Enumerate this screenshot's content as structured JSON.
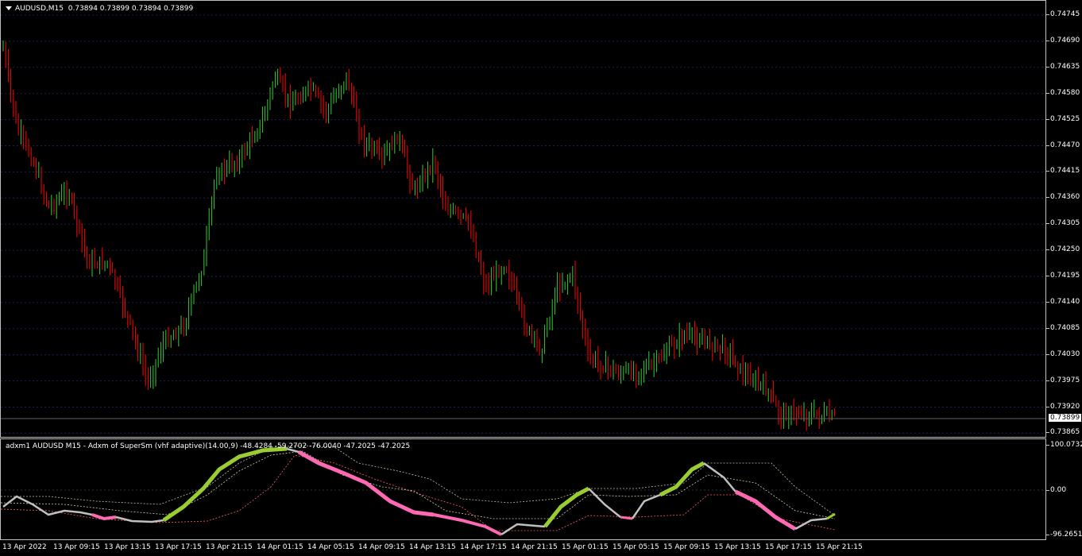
{
  "symbol_header": {
    "label": "AUDUSD,M15",
    "ohlc": "0.73894 0.73899 0.73894 0.73899"
  },
  "indicator_header": "adxm1 AUDUSD M15 - Adxm of SuperSm (vhf adaptive)(14.00,9) -48.4284 -59.2702 -76.0040 -47.2025 -47.2025",
  "colors": {
    "background": "#000000",
    "bull": "#32cd32",
    "bear": "#ff0000",
    "grid": "#1e1e50",
    "ind_up": "#9acd32",
    "ind_down": "#ff69b4",
    "ind_neutral": "#c0c0c0",
    "level_upper": "#c0c0a0",
    "level_lower": "#ff6060"
  },
  "price_axis": [
    "0.74745",
    "0.74690",
    "0.74635",
    "0.74580",
    "0.74525",
    "0.74470",
    "0.74415",
    "0.74360",
    "0.74305",
    "0.74250",
    "0.74195",
    "0.74140",
    "0.74085",
    "0.74030",
    "0.73975",
    "0.73920",
    "0.73865"
  ],
  "current_price": "0.73899",
  "indicator_axis": [
    "100.0732",
    "0.00",
    "-96.2651"
  ],
  "time_axis": [
    "13 Apr 2022",
    "13 Apr 09:15",
    "13 Apr 13:15",
    "13 Apr 17:15",
    "13 Apr 21:15",
    "14 Apr 01:15",
    "14 Apr 05:15",
    "14 Apr 09:15",
    "14 Apr 13:15",
    "14 Apr 17:15",
    "14 Apr 21:15",
    "15 Apr 01:15",
    "15 Apr 05:15",
    "15 Apr 09:15",
    "15 Apr 13:15",
    "15 Apr 17:15",
    "15 Apr 21:15"
  ]
}
